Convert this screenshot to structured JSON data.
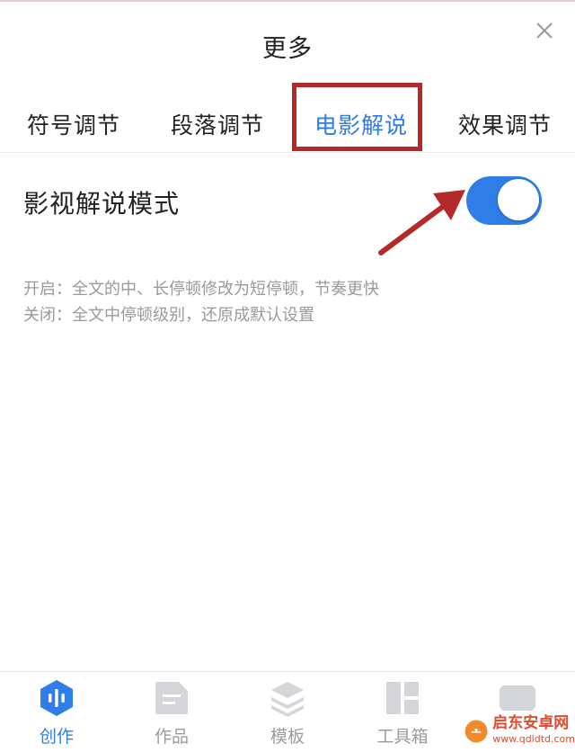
{
  "sheet": {
    "title": "更多"
  },
  "tabs": [
    {
      "label": "符号调节",
      "active": false
    },
    {
      "label": "段落调节",
      "active": false
    },
    {
      "label": "电影解说",
      "active": true
    },
    {
      "label": "效果调节",
      "active": false
    }
  ],
  "setting": {
    "label": "影视解说模式",
    "enabled": true,
    "desc_on": "开启：全文的中、长停顿修改为短停顿，节奏更快",
    "desc_off": "关闭：全文中停顿级别，还原成默认设置"
  },
  "bottom_nav": [
    {
      "label": "创作",
      "icon": "audio-wave-icon",
      "active": true
    },
    {
      "label": "作品",
      "icon": "document-icon",
      "active": false
    },
    {
      "label": "模板",
      "icon": "layers-icon",
      "active": false
    },
    {
      "label": "工具箱",
      "icon": "grid-tools-icon",
      "active": false
    }
  ],
  "watermark": {
    "name": "启东安卓网",
    "url": "www.qdldtd.com"
  },
  "colors": {
    "accent": "#2f7de6",
    "highlight": "#b42a2a",
    "muted": "#9a9a9a"
  }
}
